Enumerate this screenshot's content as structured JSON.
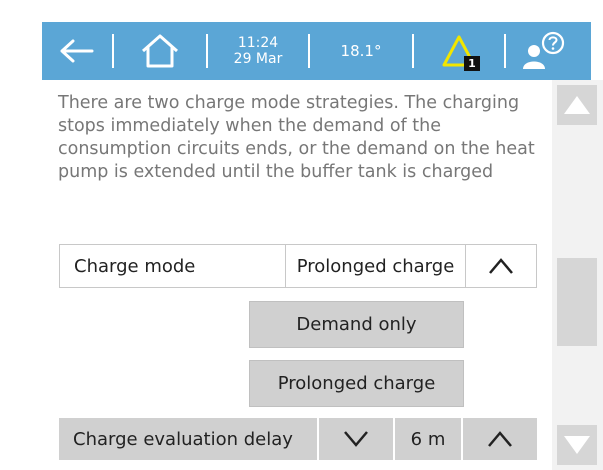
{
  "topbar": {
    "back_icon": "back-arrow-icon",
    "home_icon": "home-icon",
    "time": "11:24",
    "date": "29 Mar",
    "temperature": "18.1°",
    "alarm_icon": "warning-triangle-icon",
    "alarm_count": "1",
    "help_icon": "user-help-icon",
    "colors": {
      "bar": "#5ba6d6",
      "warning": "#f2e600"
    }
  },
  "content": {
    "description": "There are two charge mode strategies. The charging stops immediately when the demand of the consumption circuits ends, or the demand on the heat pump is extended until the buffer tank is charged",
    "charge_mode": {
      "label": "Charge mode",
      "value": "Prolonged charge",
      "toggle_icon": "chevron-up-icon",
      "options": [
        "Demand only",
        "Prolonged charge"
      ]
    },
    "charge_evaluation_delay": {
      "label": "Charge evaluation delay",
      "decrease_icon": "chevron-down-icon",
      "value": "6 m",
      "increase_icon": "chevron-up-icon"
    }
  },
  "scrollbar": {
    "up_icon": "scroll-up-icon",
    "down_icon": "scroll-down-icon"
  }
}
